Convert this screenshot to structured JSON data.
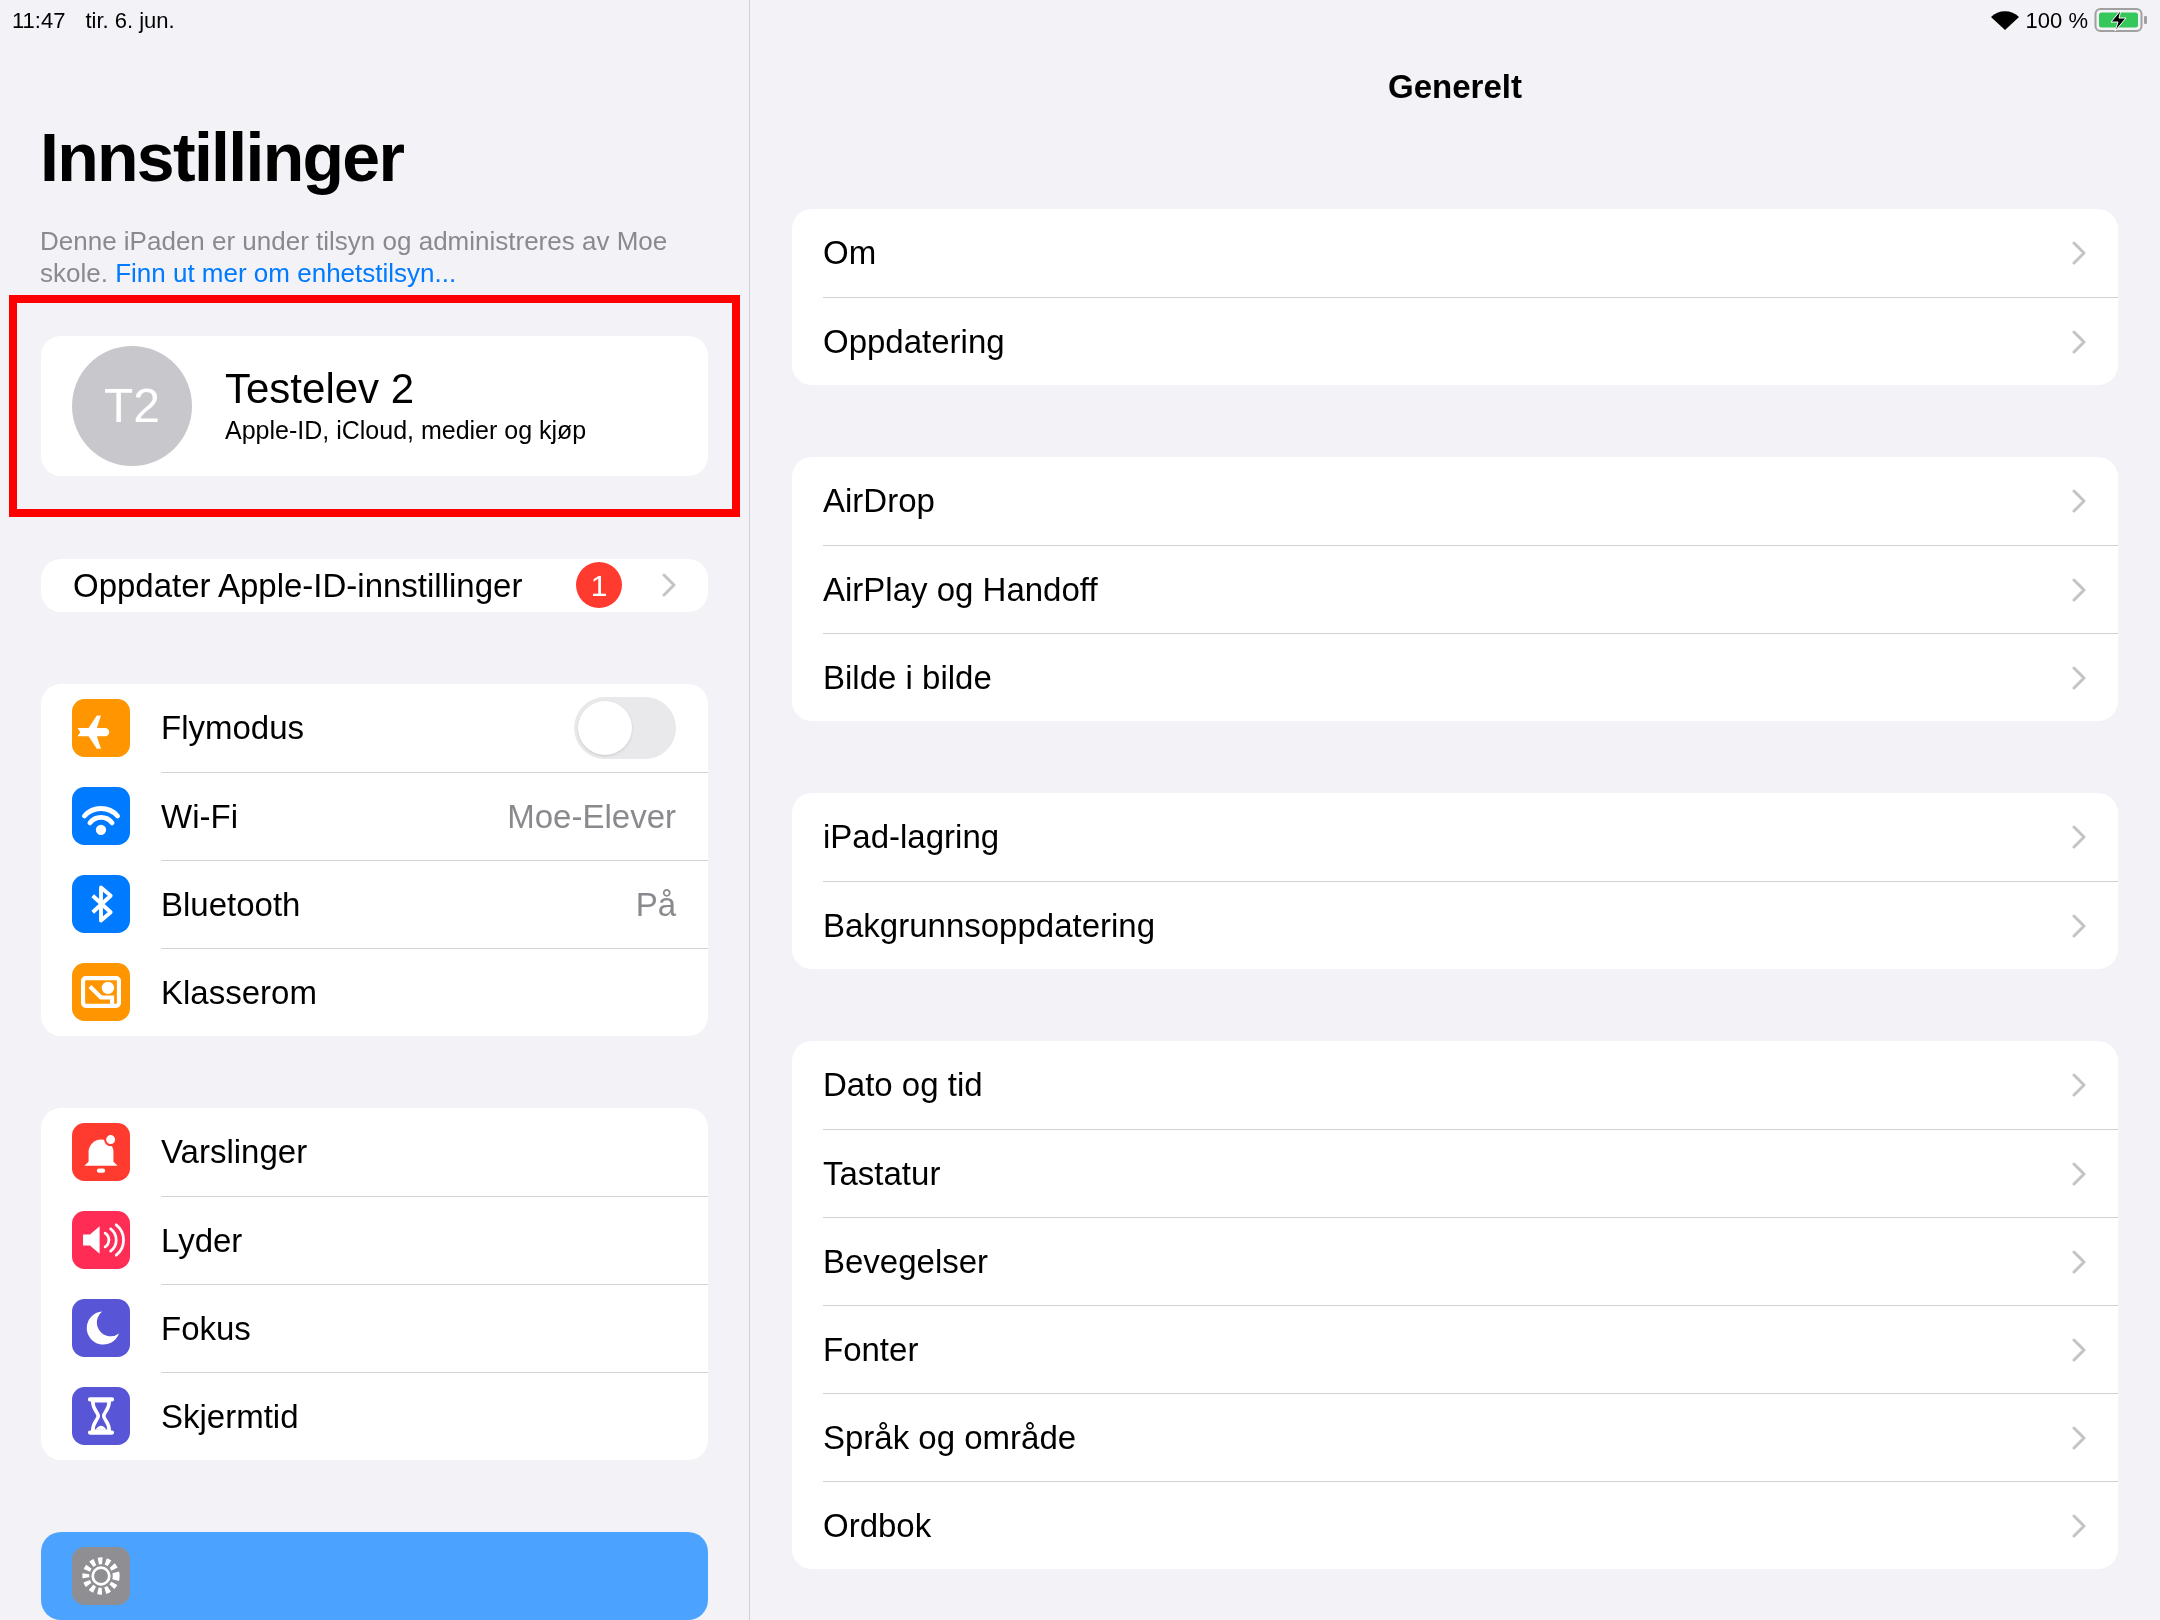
{
  "status_bar": {
    "time": "11:47",
    "date": "tir. 6. jun.",
    "battery": "100 %"
  },
  "sidebar": {
    "title": "Innstillinger",
    "notice": "Denne iPaden er under tilsyn og administreres av Moe skole.",
    "notice_link": "Finn ut mer om enhetstilsyn...",
    "profile": {
      "initials": "T2",
      "name": "Testelev 2",
      "subtitle": "Apple-ID, iCloud, medier og kjøp"
    },
    "update_row": {
      "label": "Oppdater Apple-ID-innstillinger",
      "badge": "1"
    },
    "groups": [
      [
        {
          "kind": "toggle",
          "label": "Flymodus",
          "color": "#ff9500",
          "on": false,
          "selected": false
        },
        {
          "kind": "value",
          "label": "Wi-Fi",
          "value": "Moe-Elever",
          "color": "#007aff",
          "selected": false
        },
        {
          "kind": "value",
          "label": "Bluetooth",
          "value": "På",
          "color": "#007aff",
          "selected": false
        },
        {
          "kind": "plain",
          "label": "Klasserom",
          "color": "#ff9500",
          "selected": false
        }
      ],
      [
        {
          "kind": "plain",
          "label": "Varslinger",
          "color": "#ff3b30",
          "selected": false
        },
        {
          "kind": "plain",
          "label": "Lyder",
          "color": "#ff2d55",
          "selected": false
        },
        {
          "kind": "plain",
          "label": "Fokus",
          "color": "#5856d6",
          "selected": false
        },
        {
          "kind": "plain",
          "label": "Skjermtid",
          "color": "#5856d6",
          "selected": false
        }
      ],
      [
        {
          "kind": "plain",
          "color": "#8e8e93",
          "selected": true
        }
      ]
    ]
  },
  "detail": {
    "title": "Generelt",
    "groups": [
      [
        "Om",
        "Oppdatering"
      ],
      [
        "AirDrop",
        "AirPlay og Handoff",
        "Bilde i bilde"
      ],
      [
        "iPad-lagring",
        "Bakgrunnsoppdatering"
      ],
      [
        "Dato og tid",
        "Tastatur",
        "Bevegelser",
        "Fonter",
        "Språk og område",
        "Ordbok"
      ]
    ]
  }
}
